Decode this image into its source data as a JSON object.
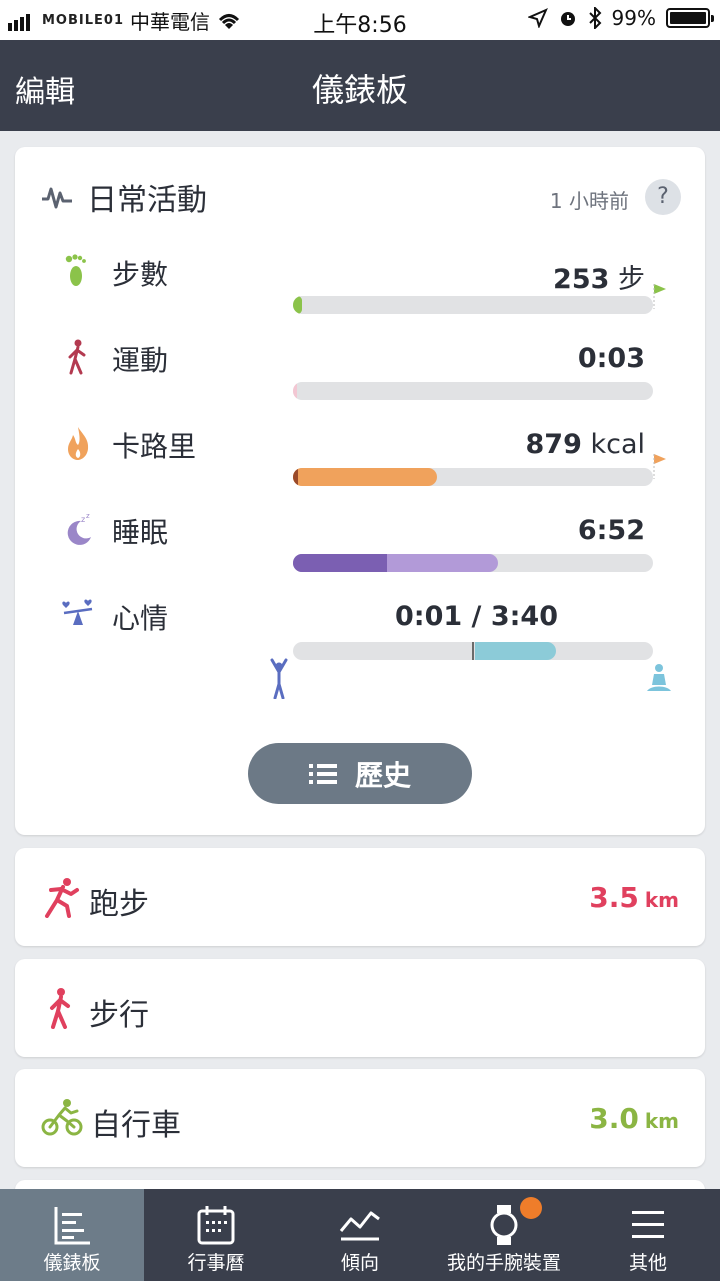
{
  "status_bar": {
    "watermark": "MOBILE01",
    "carrier": "中華電信",
    "time": "上午8:56",
    "battery": "99%",
    "icons": [
      "signal-icon",
      "wifi-icon",
      "location-icon",
      "alarm-icon",
      "bluetooth-icon",
      "battery-icon"
    ]
  },
  "header": {
    "edit_label": "編輯",
    "title": "儀錶板"
  },
  "daily_activity": {
    "title": "日常活動",
    "updated": "1 小時前",
    "help": "?",
    "metrics": [
      {
        "label": "步數",
        "value": "253",
        "unit": " 步",
        "icon": "footprint-icon",
        "progress": 0.025,
        "color": "#8bc34a",
        "goal_flag": true
      },
      {
        "label": "運動",
        "value": "0:03",
        "unit": "",
        "icon": "walking-person-icon",
        "progress": 0.01,
        "color": "#f3c7d3",
        "goal_flag": false
      },
      {
        "label": "卡路里",
        "value": "879",
        "unit": " kcal",
        "icon": "flame-icon",
        "progress": 0.4,
        "color": "#f0a25c",
        "goal_flag": true
      },
      {
        "label": "睡眠",
        "value": "6:52",
        "unit": "",
        "icon": "moon-sleep-icon",
        "deep_progress": 0.26,
        "light_progress": 0.57,
        "color": "#7b5fb2",
        "goal_flag": false
      },
      {
        "label": "心情",
        "value": "0:01 / 3:40",
        "unit": "",
        "icon": "mood-balance-icon",
        "progress_start": 0.505,
        "progress_end": 0.73,
        "color": "#8ccbd8",
        "goal_flag": false
      }
    ],
    "history_label": "歷史"
  },
  "activities": [
    {
      "label": "跑步",
      "value": "3.5",
      "unit": "km",
      "icon": "running-icon",
      "color": "#e0405e"
    },
    {
      "label": "步行",
      "value": "",
      "unit": "",
      "icon": "walking-icon",
      "color": "#e0405e"
    },
    {
      "label": "自行車",
      "value": "3.0",
      "unit": "km",
      "icon": "cycling-icon",
      "color": "#8bb543"
    }
  ],
  "tabbar": {
    "tabs": [
      {
        "label": "儀錶板",
        "icon": "dashboard-icon",
        "active": true
      },
      {
        "label": "行事曆",
        "icon": "calendar-icon",
        "active": false
      },
      {
        "label": "傾向",
        "icon": "trend-icon",
        "active": false
      },
      {
        "label": "我的手腕裝置",
        "icon": "watch-icon",
        "active": false,
        "badge": true
      },
      {
        "label": "其他",
        "icon": "menu-icon",
        "active": false
      }
    ]
  }
}
